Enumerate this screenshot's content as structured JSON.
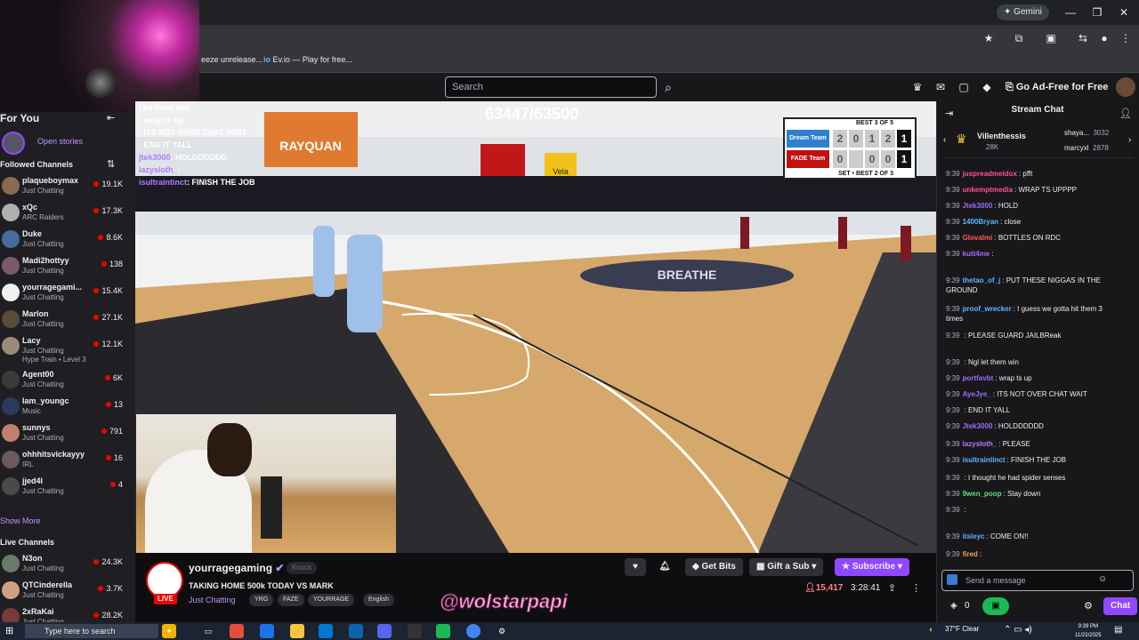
{
  "browser": {
    "gemini_label": "Gemini",
    "bookmarks": [
      "eeze unrelease...",
      "Ev.io — Play for free..."
    ]
  },
  "topbar": {
    "search_placeholder": "Search",
    "ad_free_label": "Go Ad-Free for Free"
  },
  "sidebar": {
    "for_you_label": "For You",
    "open_stories_label": "Open stories",
    "followed_header": "Followed Channels",
    "followed": [
      {
        "name": "plaqueboymax",
        "game": "Just Chatting",
        "viewers": "19.1K",
        "color": "#8a6b52"
      },
      {
        "name": "xQc",
        "game": "ARC Raiders",
        "viewers": "17.3K",
        "color": "#b0b0b0"
      },
      {
        "name": "Duke",
        "game": "Just Chatting",
        "viewers": "8.6K",
        "color": "#4a6a9a"
      },
      {
        "name": "Madi2hottyy",
        "game": "Just Chatting",
        "viewers": "138",
        "color": "#7a5a6a"
      },
      {
        "name": "yourragegami...",
        "game": "Just Chatting",
        "viewers": "15.4K",
        "color": "#f0f0f0"
      },
      {
        "name": "Marlon",
        "game": "Just Chatting",
        "viewers": "27.1K",
        "color": "#5a4a3a"
      },
      {
        "name": "Lacy",
        "game": "Just Chatting",
        "viewers": "12.1K",
        "color": "#9a8a7a",
        "extra": "Hype Train • Level 3"
      },
      {
        "name": "Agent00",
        "game": "Just Chatting",
        "viewers": "6K",
        "color": "#3a3a3a"
      },
      {
        "name": "Iam_youngc",
        "game": "Music",
        "viewers": "13",
        "color": "#2a3a5a"
      },
      {
        "name": "sunnys",
        "game": "Just Chatting",
        "viewers": "791",
        "color": "#c08070"
      },
      {
        "name": "ohhhitsvickayyy",
        "game": "IRL",
        "viewers": "16",
        "color": "#6a5a5a"
      },
      {
        "name": "jjed4l",
        "game": "Just Chatting",
        "viewers": "4",
        "color": "#4a4a4a"
      }
    ],
    "show_more_label": "Show More",
    "live_header": "Live Channels",
    "live": [
      {
        "name": "N3on",
        "game": "Just Chatting",
        "viewers": "24.3K",
        "color": "#6a7a6a"
      },
      {
        "name": "QTCinderella",
        "game": "Just Chatting",
        "viewers": "3.7K",
        "color": "#d0a080"
      },
      {
        "name": "2xRaKai",
        "game": "Just Chatting",
        "viewers": "28.2K",
        "color": "#7a3a3a"
      }
    ]
  },
  "video": {
    "viewer_overlay": "63447/63500",
    "overlay_chat": [
      {
        "user": "",
        "text": "I let them win"
      },
      {
        "user": "",
        "text": ": wrap ts up"
      },
      {
        "user": "",
        "text": ": ITS NOT OVER CHAT WAIT"
      },
      {
        "user": "",
        "text": ": END IT YALL"
      },
      {
        "user": "jtek3000",
        "text": ": HOLDDDDDD"
      },
      {
        "user": "lazysloth_",
        "text": ":"
      },
      {
        "user": "isultraintinct",
        "text": ": FINISH THE JOB"
      }
    ],
    "court_banners": [
      "RAYQUAN",
      "Vela",
      "BREATHE"
    ],
    "scoreboard": {
      "title": "BEST 3 OF 5",
      "teams": [
        {
          "name": "Dream Team",
          "scores": [
            "2",
            "0",
            "1",
            "2",
            "1"
          ],
          "color": "#2f7fd0"
        },
        {
          "name": "FADE Team",
          "scores": [
            "0",
            "",
            "0",
            "0",
            "1"
          ],
          "color": "#c01010"
        }
      ],
      "footer": "SET • BEST 2 OF 3"
    }
  },
  "stream": {
    "channel": "yourragegaming",
    "live_label": "LIVE",
    "title": "TAKING HOME 500k TODAY VS MARK",
    "game": "Just Chatting",
    "tags": [
      "YRG",
      "FAZE",
      "YOURRAGE",
      "English"
    ],
    "knock_label": "Knock",
    "get_bits_label": "Get Bits",
    "gift_sub_label": "Gift a Sub",
    "subscribe_label": "Subscribe",
    "viewers": "15,417",
    "uptime": "3:28:41",
    "watermark": "@wolstarpapi"
  },
  "chat": {
    "header": "Stream Chat",
    "hype": {
      "user": "Villenthessis",
      "count1": "28K",
      "top": [
        {
          "name": "shaya...",
          "count": "3032"
        },
        {
          "name": "marcyxl",
          "count": "2878"
        }
      ]
    },
    "messages": [
      {
        "time": "9:39",
        "user": "juspreadmeldox",
        "text": ": pfft",
        "color": "#ff4f9a"
      },
      {
        "time": "9:39",
        "user": "unkemptmedia",
        "text": ": WRAP TS UPPPP",
        "color": "#ff4f9a"
      },
      {
        "time": "9:39",
        "user": "Jtek3000",
        "text": ": HOLD",
        "color": "#9b6cff"
      },
      {
        "time": "9:39",
        "user": "1400Bryan",
        "text": ": close",
        "color": "#5fb4ff"
      },
      {
        "time": "9:39",
        "user": "Glovalmi",
        "text": ": BOTTLES ON RDC",
        "color": "#ff5a5a"
      },
      {
        "time": "9:39",
        "user": "kutt4me",
        "text": ":",
        "color": "#9b6cff"
      },
      {
        "time": "9:39",
        "user": "thetao_of_j",
        "text": ": PUT THESE NIGGAS IN THE GROUND",
        "color": "#5fb4ff"
      },
      {
        "time": "9:39",
        "user": "proof_wrecker",
        "text": ": I guess we gotta hit them 3 times",
        "color": "#5fb4ff"
      },
      {
        "time": "9:39",
        "user": "",
        "text": ": PLEASE GUARD JAILBReak",
        "color": "#ff4f4f"
      },
      {
        "time": "9:39",
        "user": "",
        "text": ": Ngl let them win",
        "color": "#ff4f9a"
      },
      {
        "time": "9:39",
        "user": "portfavbt",
        "text": ": wrap ts up",
        "color": "#9b6cff"
      },
      {
        "time": "9:39",
        "user": "AyeJye_",
        "text": ": ITS NOT OVER CHAT WAIT",
        "color": "#9b6cff"
      },
      {
        "time": "9:39",
        "user": "",
        "text": ": END IT YALL",
        "color": "#ff4f4f"
      },
      {
        "time": "9:39",
        "user": "Jtek3000",
        "text": ": HOLDDDDDD",
        "color": "#9b6cff"
      },
      {
        "time": "9:39",
        "user": "lazysloth_",
        "text": ": PLEASE",
        "color": "#b07cff"
      },
      {
        "time": "9:39",
        "user": "isultraintinct",
        "text": ": FINISH THE JOB",
        "color": "#5fb4ff"
      },
      {
        "time": "9:39",
        "user": "",
        "text": ": I thought he had spider senses",
        "color": "#ff4f4f"
      },
      {
        "time": "9:39",
        "user": "9wen_poop",
        "text": ": Stay down",
        "color": "#5fdf7f"
      },
      {
        "time": "9:39",
        "user": "",
        "text": ":",
        "color": "#ff4f4f"
      },
      {
        "time": "9:39",
        "user": "itsleyc",
        "text": ": COME ON!!",
        "color": "#5fb4ff"
      },
      {
        "time": "9:39",
        "user": "fired",
        "text": ":",
        "color": "#ff9a4f"
      }
    ],
    "input_placeholder": "Send a message",
    "points": "0",
    "chat_button": "Chat"
  },
  "taskbar": {
    "search_placeholder": "Type here to search",
    "weather": "37°F  Clear",
    "time": "9:39 PM",
    "date": "11/22/2025"
  }
}
